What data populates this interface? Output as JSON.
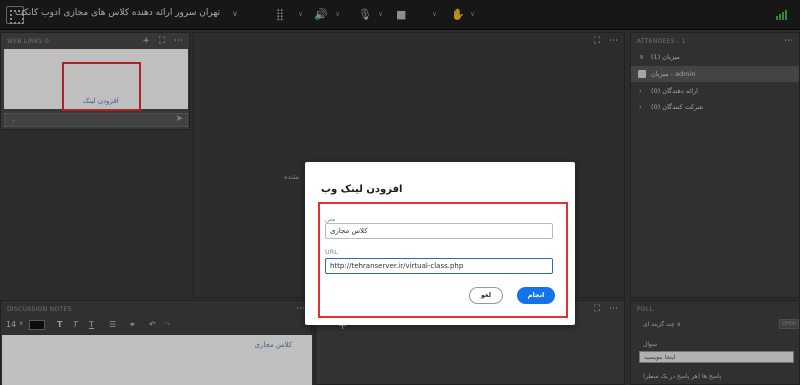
{
  "topbar": {
    "title": "تهران سرور ارائه دهنده کلاس های مجازی ادوب کانکت",
    "icons": [
      "menu-icon",
      "dropdown-chevron-icon",
      "grid-icon",
      "speaker-icon",
      "microphone-icon",
      "camera-icon",
      "raise-hand-icon",
      "signal-icon"
    ]
  },
  "weblinks": {
    "header": "WEB LINKS 0",
    "add_link": "افزودن لینک",
    "url_placeholder": "-"
  },
  "share": {
    "caption": "نشده"
  },
  "attendees": {
    "header": "ATTENDEES - 1",
    "groups": [
      {
        "label": "میزبان (1)"
      },
      {
        "label": "admin - میزبان",
        "selected": true
      },
      {
        "label": "ارائه دهندگان (0)"
      },
      {
        "label": "شرکت کنندگان (0)"
      }
    ]
  },
  "notes": {
    "header": "DISCUSSION NOTES",
    "font_size": "14",
    "content": "کلاس مجازی"
  },
  "poll": {
    "header": "POLL",
    "type_label": "چند گزینه ای",
    "question_label": "سوال",
    "question_placeholder": "اینجا بنویسید",
    "answers_label": "پاسخ ها (هر پاسخ در یک سطر)",
    "open_button": "OPEN"
  },
  "dialog": {
    "title": "افزودن لینک وب",
    "text_label": "متن",
    "text_value": "کلاس مجازی",
    "url_label": "URL",
    "url_value": "http://tehranserver.ir/virtual-class.php",
    "cancel_label": "لغو",
    "ok_label": "انجام"
  },
  "colors": {
    "accent": "#1473e6",
    "highlight": "#e53030",
    "link": "#5a7fc4"
  }
}
